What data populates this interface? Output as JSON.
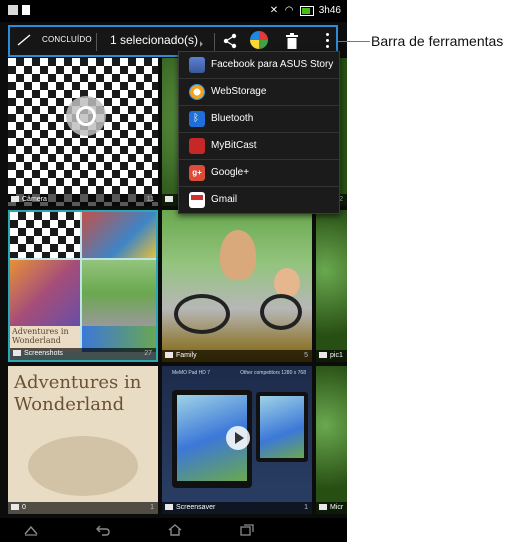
{
  "status_bar": {
    "time": "3h46",
    "icons": [
      "image-notification-icon",
      "document-notification-icon",
      "no-sim-icon",
      "wifi-icon",
      "battery-icon"
    ]
  },
  "action_bar": {
    "done_label": "CONCLUÍDO",
    "selection_label": "1 selecionado(s)",
    "accent_color": "#2e8bd6"
  },
  "share_menu": {
    "items": [
      {
        "label": "Facebook para ASUS Story",
        "icon": "facebook-icon"
      },
      {
        "label": "WebStorage",
        "icon": "webstorage-icon"
      },
      {
        "label": "Bluetooth",
        "icon": "bluetooth-icon"
      },
      {
        "label": "MyBitCast",
        "icon": "mybitcast-icon"
      },
      {
        "label": "Google+",
        "icon": "google-plus-icon",
        "glyph": "g+"
      },
      {
        "label": "Gmail",
        "icon": "gmail-icon"
      }
    ]
  },
  "albums": [
    {
      "name": "Câmera",
      "count": "11"
    },
    {
      "name": "",
      "count": "2"
    },
    {
      "name": "Screenshots",
      "count": "27"
    },
    {
      "name": "Family",
      "count": "5"
    },
    {
      "name": "pic1",
      "count": ""
    },
    {
      "name": "0",
      "count": "1"
    },
    {
      "name": "Screensaver",
      "count": "1"
    },
    {
      "name": "Micr",
      "count": ""
    }
  ],
  "thumb_text": {
    "wonderland": "Adventures in Wonderland",
    "wonderland_small": "Adventures in Wonderland",
    "screensaver_left": "MeMO Pad HD 7",
    "screensaver_right": "Other competitors 1280 x 768"
  },
  "nav_bar": {
    "icons": [
      "back-icon",
      "back-arrow-icon",
      "home-icon",
      "recent-apps-icon"
    ]
  },
  "callout": {
    "label": "Barra de ferramentas"
  }
}
